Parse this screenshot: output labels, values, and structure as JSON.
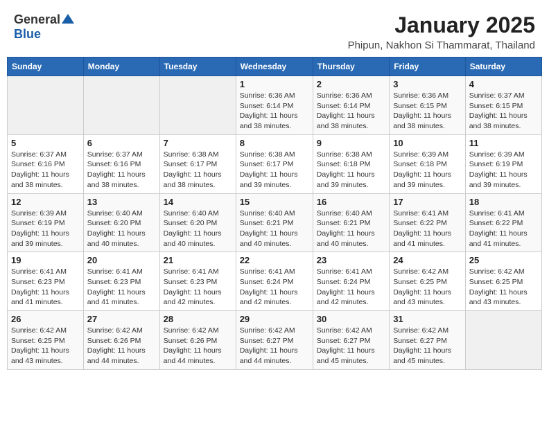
{
  "logo": {
    "general": "General",
    "blue": "Blue"
  },
  "title": "January 2025",
  "location": "Phipun, Nakhon Si Thammarat, Thailand",
  "weekdays": [
    "Sunday",
    "Monday",
    "Tuesday",
    "Wednesday",
    "Thursday",
    "Friday",
    "Saturday"
  ],
  "weeks": [
    [
      {
        "day": "",
        "info": ""
      },
      {
        "day": "",
        "info": ""
      },
      {
        "day": "",
        "info": ""
      },
      {
        "day": "1",
        "info": "Sunrise: 6:36 AM\nSunset: 6:14 PM\nDaylight: 11 hours\nand 38 minutes."
      },
      {
        "day": "2",
        "info": "Sunrise: 6:36 AM\nSunset: 6:14 PM\nDaylight: 11 hours\nand 38 minutes."
      },
      {
        "day": "3",
        "info": "Sunrise: 6:36 AM\nSunset: 6:15 PM\nDaylight: 11 hours\nand 38 minutes."
      },
      {
        "day": "4",
        "info": "Sunrise: 6:37 AM\nSunset: 6:15 PM\nDaylight: 11 hours\nand 38 minutes."
      }
    ],
    [
      {
        "day": "5",
        "info": "Sunrise: 6:37 AM\nSunset: 6:16 PM\nDaylight: 11 hours\nand 38 minutes."
      },
      {
        "day": "6",
        "info": "Sunrise: 6:37 AM\nSunset: 6:16 PM\nDaylight: 11 hours\nand 38 minutes."
      },
      {
        "day": "7",
        "info": "Sunrise: 6:38 AM\nSunset: 6:17 PM\nDaylight: 11 hours\nand 38 minutes."
      },
      {
        "day": "8",
        "info": "Sunrise: 6:38 AM\nSunset: 6:17 PM\nDaylight: 11 hours\nand 39 minutes."
      },
      {
        "day": "9",
        "info": "Sunrise: 6:38 AM\nSunset: 6:18 PM\nDaylight: 11 hours\nand 39 minutes."
      },
      {
        "day": "10",
        "info": "Sunrise: 6:39 AM\nSunset: 6:18 PM\nDaylight: 11 hours\nand 39 minutes."
      },
      {
        "day": "11",
        "info": "Sunrise: 6:39 AM\nSunset: 6:19 PM\nDaylight: 11 hours\nand 39 minutes."
      }
    ],
    [
      {
        "day": "12",
        "info": "Sunrise: 6:39 AM\nSunset: 6:19 PM\nDaylight: 11 hours\nand 39 minutes."
      },
      {
        "day": "13",
        "info": "Sunrise: 6:40 AM\nSunset: 6:20 PM\nDaylight: 11 hours\nand 40 minutes."
      },
      {
        "day": "14",
        "info": "Sunrise: 6:40 AM\nSunset: 6:20 PM\nDaylight: 11 hours\nand 40 minutes."
      },
      {
        "day": "15",
        "info": "Sunrise: 6:40 AM\nSunset: 6:21 PM\nDaylight: 11 hours\nand 40 minutes."
      },
      {
        "day": "16",
        "info": "Sunrise: 6:40 AM\nSunset: 6:21 PM\nDaylight: 11 hours\nand 40 minutes."
      },
      {
        "day": "17",
        "info": "Sunrise: 6:41 AM\nSunset: 6:22 PM\nDaylight: 11 hours\nand 41 minutes."
      },
      {
        "day": "18",
        "info": "Sunrise: 6:41 AM\nSunset: 6:22 PM\nDaylight: 11 hours\nand 41 minutes."
      }
    ],
    [
      {
        "day": "19",
        "info": "Sunrise: 6:41 AM\nSunset: 6:23 PM\nDaylight: 11 hours\nand 41 minutes."
      },
      {
        "day": "20",
        "info": "Sunrise: 6:41 AM\nSunset: 6:23 PM\nDaylight: 11 hours\nand 41 minutes."
      },
      {
        "day": "21",
        "info": "Sunrise: 6:41 AM\nSunset: 6:23 PM\nDaylight: 11 hours\nand 42 minutes."
      },
      {
        "day": "22",
        "info": "Sunrise: 6:41 AM\nSunset: 6:24 PM\nDaylight: 11 hours\nand 42 minutes."
      },
      {
        "day": "23",
        "info": "Sunrise: 6:41 AM\nSunset: 6:24 PM\nDaylight: 11 hours\nand 42 minutes."
      },
      {
        "day": "24",
        "info": "Sunrise: 6:42 AM\nSunset: 6:25 PM\nDaylight: 11 hours\nand 43 minutes."
      },
      {
        "day": "25",
        "info": "Sunrise: 6:42 AM\nSunset: 6:25 PM\nDaylight: 11 hours\nand 43 minutes."
      }
    ],
    [
      {
        "day": "26",
        "info": "Sunrise: 6:42 AM\nSunset: 6:25 PM\nDaylight: 11 hours\nand 43 minutes."
      },
      {
        "day": "27",
        "info": "Sunrise: 6:42 AM\nSunset: 6:26 PM\nDaylight: 11 hours\nand 44 minutes."
      },
      {
        "day": "28",
        "info": "Sunrise: 6:42 AM\nSunset: 6:26 PM\nDaylight: 11 hours\nand 44 minutes."
      },
      {
        "day": "29",
        "info": "Sunrise: 6:42 AM\nSunset: 6:27 PM\nDaylight: 11 hours\nand 44 minutes."
      },
      {
        "day": "30",
        "info": "Sunrise: 6:42 AM\nSunset: 6:27 PM\nDaylight: 11 hours\nand 45 minutes."
      },
      {
        "day": "31",
        "info": "Sunrise: 6:42 AM\nSunset: 6:27 PM\nDaylight: 11 hours\nand 45 minutes."
      },
      {
        "day": "",
        "info": ""
      }
    ]
  ]
}
